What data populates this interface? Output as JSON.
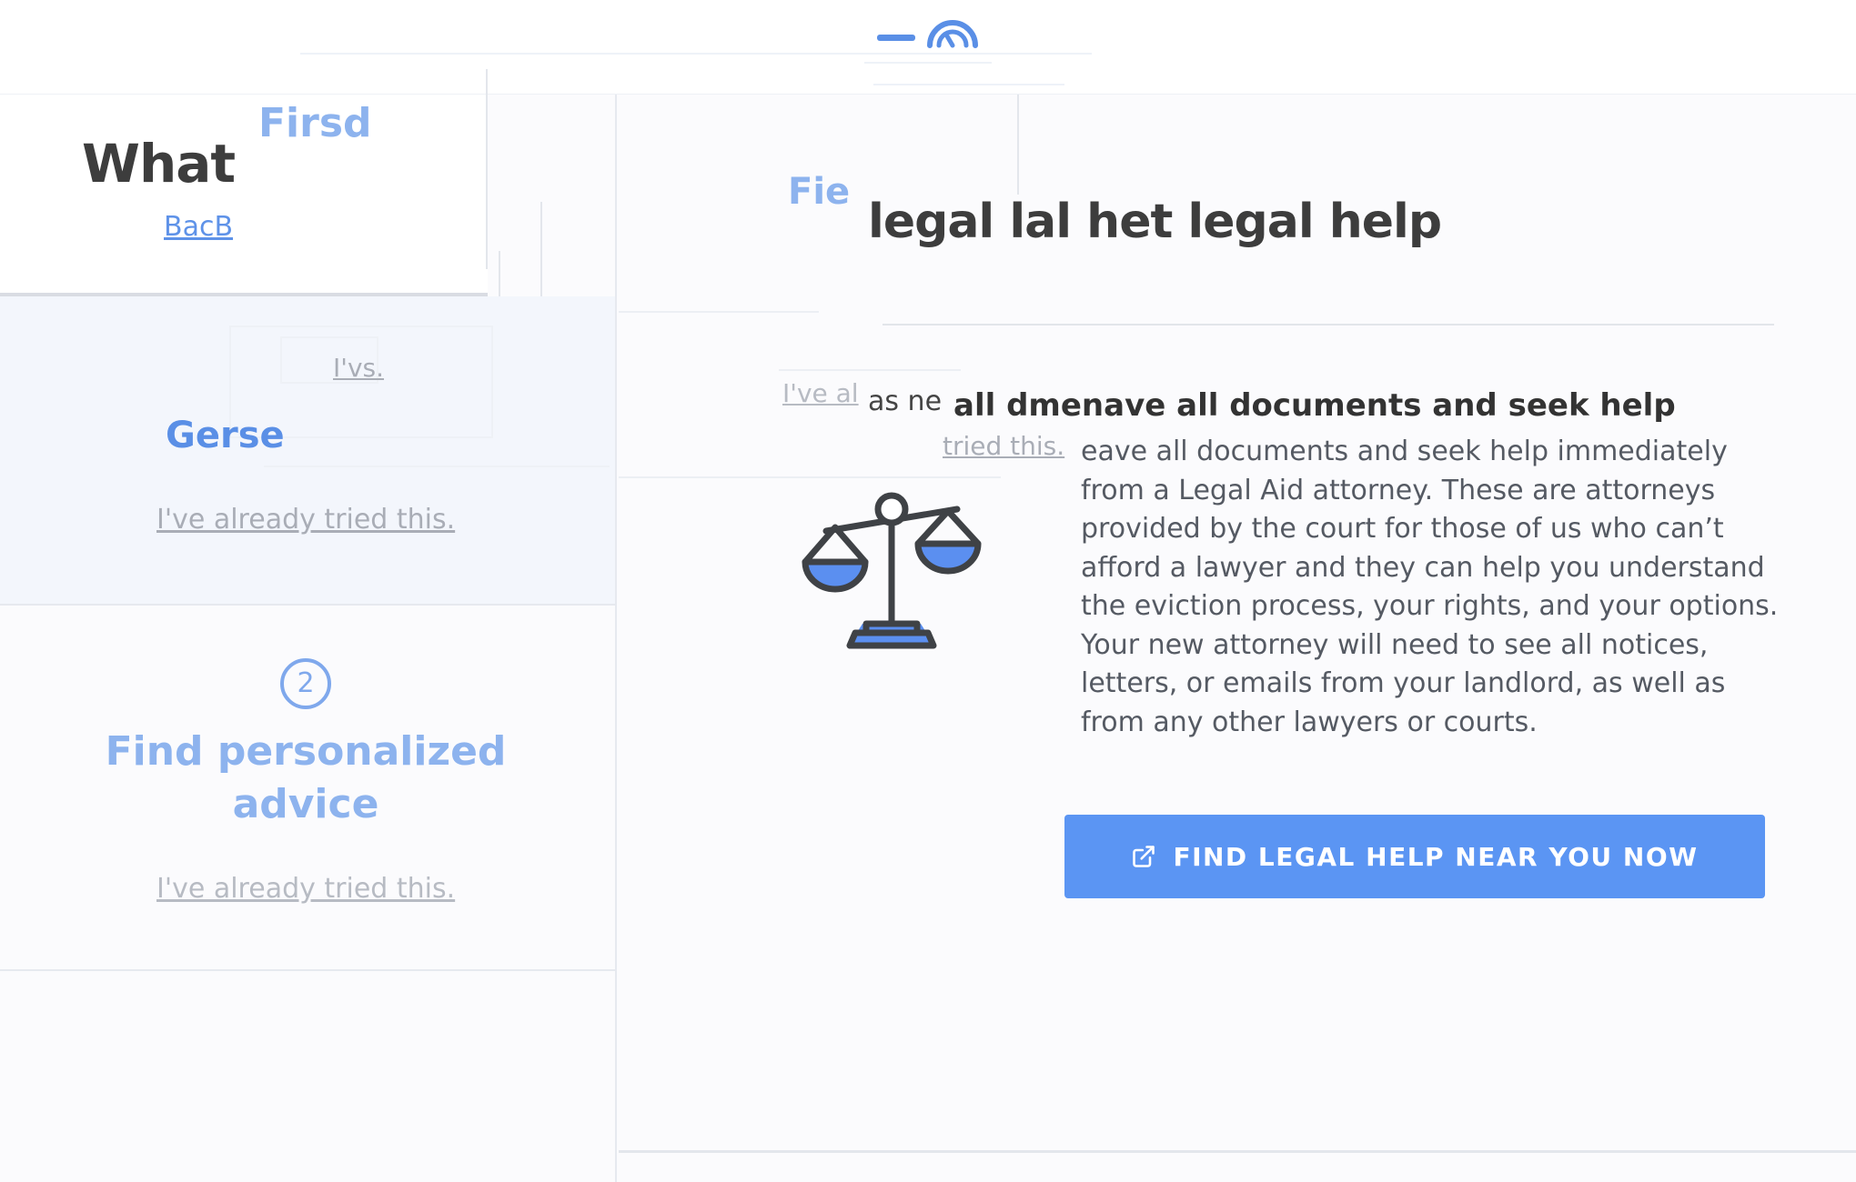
{
  "header": {
    "logo_icon": "gauge-logo-icon",
    "accent": "#5a8fe6"
  },
  "sidebar": {
    "heading": "What",
    "ghost_heading": "Firsd",
    "back_link": "BacB",
    "ghost_tried": "I'vs.",
    "step1_title": "Gerse",
    "step1_tried": "I've already tried this.",
    "step2_number": "2",
    "step2_title": "Find personalized advice",
    "step2_tried": "I've already tried this."
  },
  "main": {
    "ghost_step_title": "Fie",
    "title": "legal lal het legal help",
    "ghost_tried_prefix": "I've al",
    "ghost_fragment": "as  ne",
    "option_heading": "all dmenave all documents and seek help",
    "ghost_tried_suffix": "tried this.",
    "option_body": "eave all documents and seek help immediately from a Legal Aid attorney. These are attorneys provided by the court for those of us who can’t afford a lawyer and they can help you understand the eviction process, your rights, and your options. Your new attorney will need to see all notices, letters, or emails from your landlord, as well as from any other lawyers or courts.",
    "icon": "scales-of-justice-icon",
    "cta_label": "FIND LEGAL HELP NEAR YOU NOW",
    "cta_icon": "external-link-icon",
    "cta_color": "#5b95f3"
  }
}
